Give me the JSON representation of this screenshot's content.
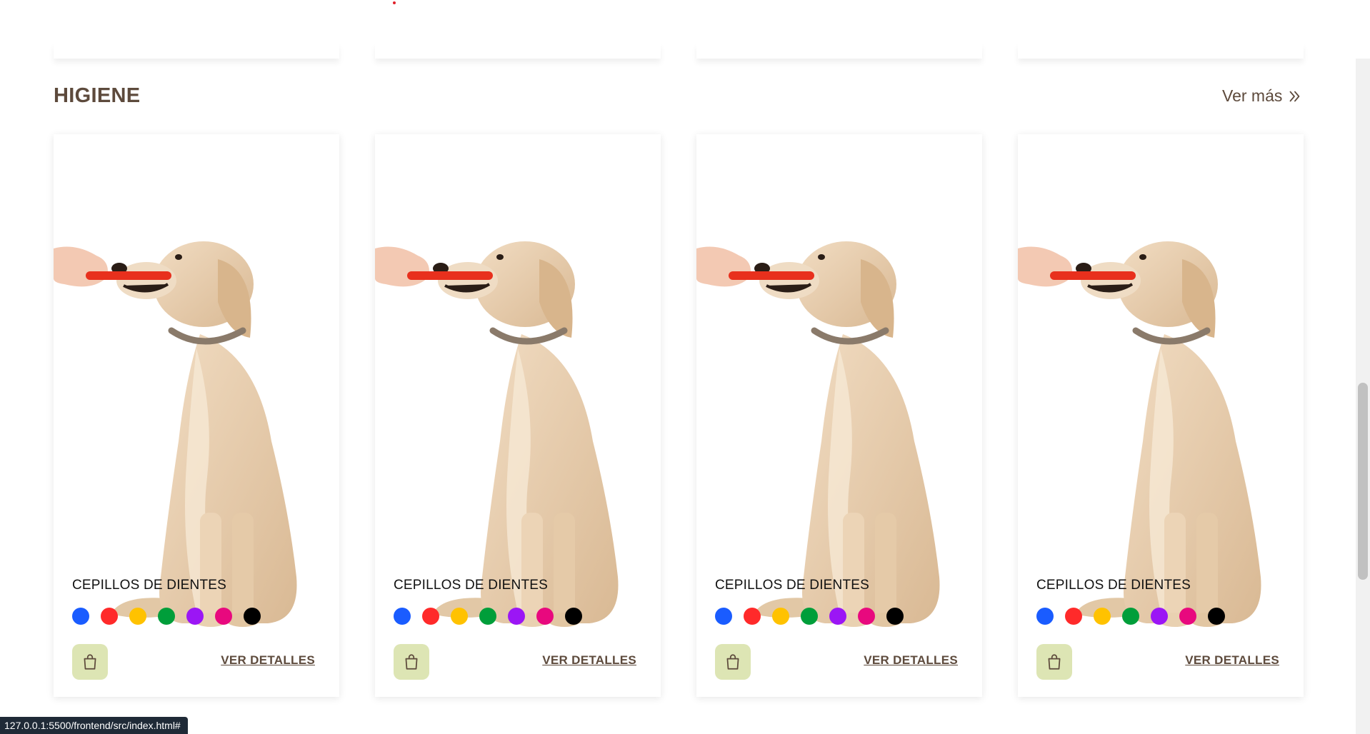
{
  "section": {
    "title": "HIGIENE",
    "see_more": "Ver más"
  },
  "product_cards": [
    {
      "name": "CEPILLOS DE DIENTES",
      "details_label": "VER DETALLES"
    },
    {
      "name": "CEPILLOS DE DIENTES",
      "details_label": "VER DETALLES"
    },
    {
      "name": "CEPILLOS DE DIENTES",
      "details_label": "VER DETALLES"
    },
    {
      "name": "CEPILLOS DE DIENTES",
      "details_label": "VER DETALLES"
    }
  ],
  "color_options": [
    "#1a5cff",
    "#ff2a2a",
    "#ffc200",
    "#009e3a",
    "#9b16f5",
    "#e8097e",
    "#000000"
  ],
  "icons": {
    "see_more": "double-chevron-right-icon",
    "cart": "shopping-bag-icon"
  },
  "theme": {
    "brown": "#5d4a3c",
    "cart_bg": "#dde5b4"
  },
  "status_bar": {
    "url": "127.0.0.1:5500/frontend/src/index.html#"
  }
}
